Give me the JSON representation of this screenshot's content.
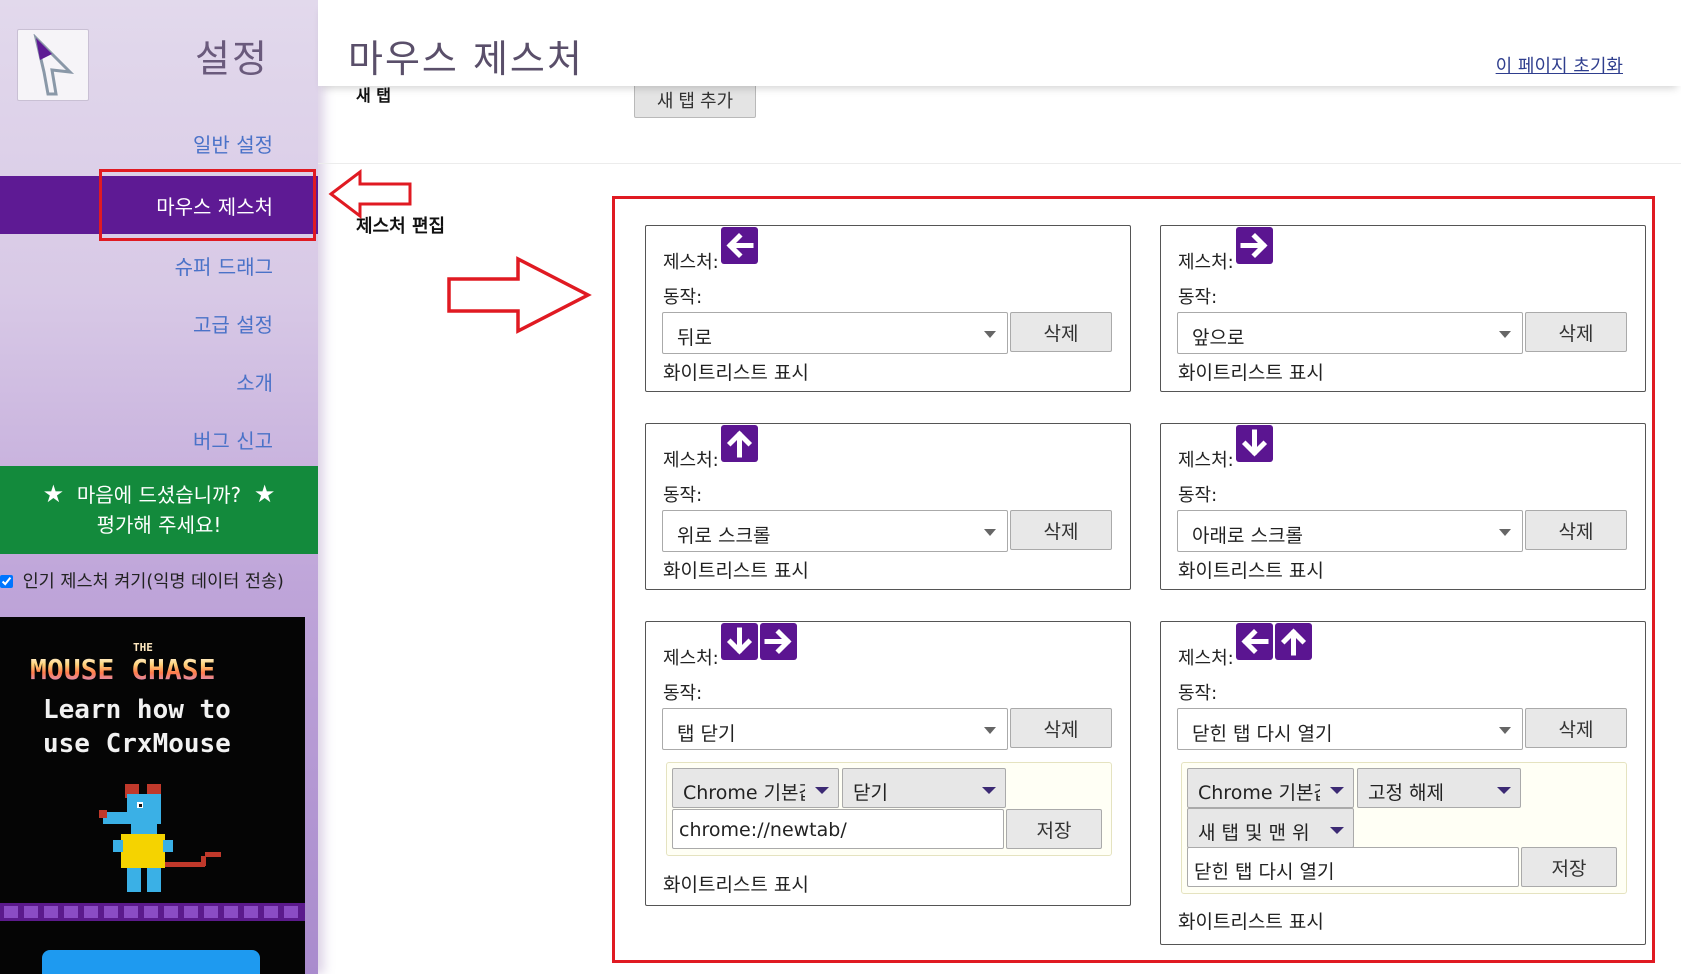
{
  "sidebar": {
    "title": "설정",
    "nav": [
      {
        "label": "일반 설정",
        "active": false
      },
      {
        "label": "마우스 제스처",
        "active": true
      },
      {
        "label": "슈퍼 드래그",
        "active": false
      },
      {
        "label": "고급 설정",
        "active": false
      },
      {
        "label": "소개",
        "active": false
      },
      {
        "label": "버그 신고",
        "active": false
      }
    ],
    "rate_line1": "마음에 드셨습니까?",
    "rate_line2": "평가해 주세요!",
    "popular_label": "인기 제스처 켜기(익명 데이터 전송)",
    "popular_checked": true,
    "ad": {
      "small_title": "THE",
      "title": "MOUSE CHASE",
      "line1": "Learn how to",
      "line2": "use CrxMouse"
    }
  },
  "header": {
    "title": "마우스 제스처",
    "reset_link": "이 페이지 초기화"
  },
  "main": {
    "new_tab_label": "새 탭",
    "add_new_tab_button": "새 탭 추가",
    "gesture_edit_label": "제스처 편집"
  },
  "card_labels": {
    "gesture": "제스처:",
    "action": "동작:",
    "delete": "삭제",
    "whitelist": "화이트리스트 표시",
    "save": "저장"
  },
  "cards": [
    {
      "arrows": [
        "left"
      ],
      "action": "뒤로"
    },
    {
      "arrows": [
        "right"
      ],
      "action": "앞으로"
    },
    {
      "arrows": [
        "up"
      ],
      "action": "위로 스크롤"
    },
    {
      "arrows": [
        "down"
      ],
      "action": "아래로 스크롤"
    },
    {
      "arrows": [
        "down",
        "right"
      ],
      "action": "탭 닫기",
      "options": {
        "select1": "Chrome 기본값",
        "select2": "닫기",
        "url_value": "chrome://newtab/"
      }
    },
    {
      "arrows": [
        "left",
        "up"
      ],
      "action": "닫힌 탭 다시 열기",
      "options": {
        "select1": "Chrome 기본값",
        "select2": "고정 해제",
        "select3": "새 탭 및 맨 위",
        "text_value": "닫힌 탭 다시 열기"
      }
    }
  ],
  "colors": {
    "accent_purple": "#5e1a94",
    "arrow_purple": "#5b1591",
    "rate_green": "#138a3c",
    "nav_link": "#4a72c8",
    "annotation_red": "#e01a22"
  }
}
